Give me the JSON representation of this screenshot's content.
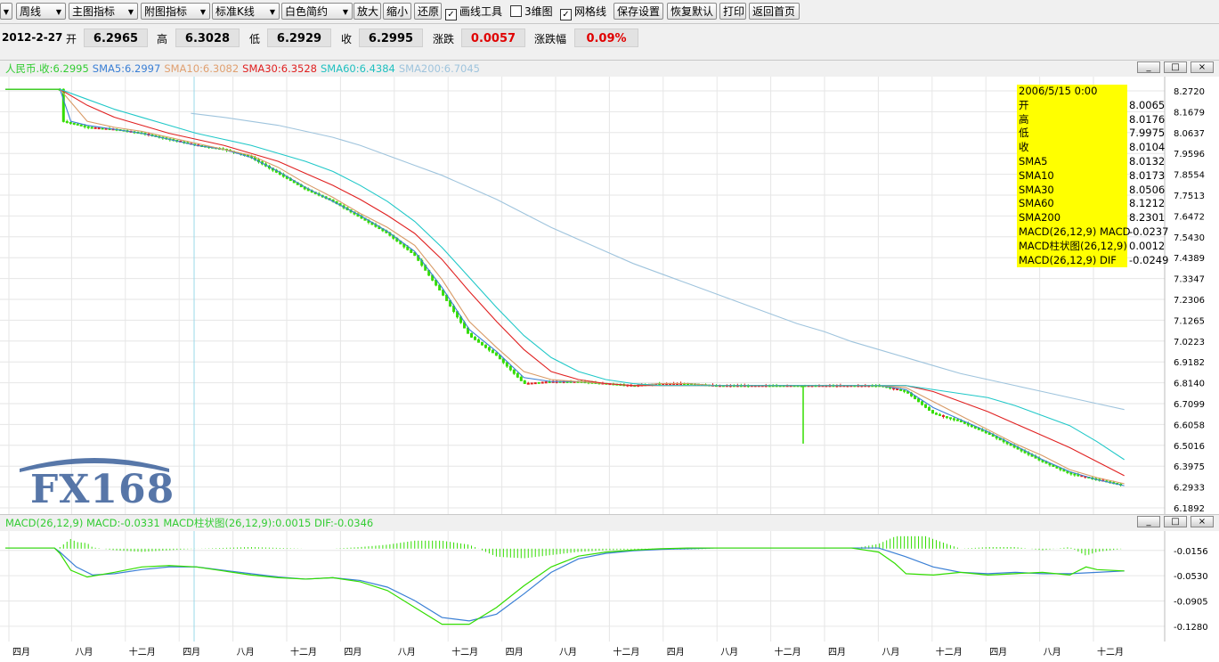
{
  "toolbar": {
    "period": "周线",
    "main_indicator": "主图指标",
    "sub_indicator": "附图指标",
    "kline_type": "标准K线",
    "theme": "白色简约",
    "zoom_in": "放大",
    "zoom_out": "缩小",
    "restore": "还原",
    "draw_tools": "画线工具",
    "three_d": "3维图",
    "grid": "网格线",
    "save_settings": "保存设置",
    "reset_default": "恢复默认",
    "print": "打印",
    "home": "返回首页",
    "draw_tools_checked": true,
    "three_d_checked": false,
    "grid_checked": true
  },
  "quote": {
    "date": "2012-2-27",
    "open_label": "开",
    "open": "6.2965",
    "high_label": "高",
    "high": "6.3028",
    "low_label": "低",
    "low": "6.2929",
    "close_label": "收",
    "close": "6.2995",
    "change_label": "涨跌",
    "change": "0.0057",
    "pct_label": "涨跌幅",
    "pct": "0.09%"
  },
  "main_legend": [
    {
      "text": "人民币.收:6.2995",
      "color": "#33cc33"
    },
    {
      "text": "SMA5:6.2997",
      "color": "#3a7fd5"
    },
    {
      "text": "SMA10:6.3082",
      "color": "#e0a070"
    },
    {
      "text": "SMA30:6.3528",
      "color": "#e02020"
    },
    {
      "text": "SMA60:6.4384",
      "color": "#20c0c0"
    },
    {
      "text": "SMA200:6.7045",
      "color": "#9fc4dd"
    }
  ],
  "macd_legend": "MACD(26,12,9) MACD:-0.0331 MACD柱状图(26,12,9):0.0015 DIF:-0.0346",
  "window_buttons": {
    "minimize": "_",
    "maximize": "□",
    "close": "×"
  },
  "tooltip": [
    {
      "label": "2006/5/15 0:00",
      "value": ""
    },
    {
      "label": "开",
      "value": "8.0065"
    },
    {
      "label": "高",
      "value": "8.0176"
    },
    {
      "label": "低",
      "value": "7.9975"
    },
    {
      "label": "收",
      "value": "8.0104"
    },
    {
      "label": "SMA5",
      "value": "8.0132"
    },
    {
      "label": "SMA10",
      "value": "8.0173"
    },
    {
      "label": "SMA30",
      "value": "8.0506"
    },
    {
      "label": "SMA60",
      "value": "8.1212"
    },
    {
      "label": "SMA200",
      "value": "8.2301"
    },
    {
      "label": "MACD(26,12,9) MACD",
      "value": "-0.0237"
    },
    {
      "label": "MACD柱状图(26,12,9)",
      "value": "0.0012"
    },
    {
      "label": "MACD(26,12,9) DIF",
      "value": "-0.0249"
    }
  ],
  "logo_text": "FX168",
  "colors": {
    "up": "#e02020",
    "down": "#33dd00",
    "grid": "#e6e6e6",
    "crosshair": "#9ad8ea",
    "tooltip_bg": "#ffff00"
  },
  "chart_data": [
    {
      "type": "line",
      "title": "",
      "y_ticks": [
        "8.2720",
        "8.1679",
        "8.0637",
        "7.9596",
        "7.8554",
        "7.7513",
        "7.6472",
        "7.5430",
        "7.4389",
        "7.3347",
        "7.2306",
        "7.1265",
        "7.0223",
        "6.9182",
        "6.8140",
        "6.7099",
        "6.6058",
        "6.5016",
        "6.3975",
        "6.2933",
        "6.1892"
      ],
      "ylim": [
        6.1892,
        8.272
      ],
      "x_ticks": [
        "四月",
        "八月",
        "十二月",
        "四月",
        "八月",
        "十二月",
        "四月",
        "八月",
        "十二月",
        "四月",
        "八月",
        "十二月",
        "四月",
        "八月",
        "十二月",
        "四月",
        "八月",
        "十二月",
        "四月",
        "八月",
        "十二月"
      ],
      "series": [
        {
          "name": "人民币.收",
          "x": [
            0,
            10,
            10.5,
            15,
            20,
            25,
            30,
            35,
            40,
            45,
            50,
            55,
            60,
            65,
            70,
            75,
            80,
            85,
            90,
            95,
            100,
            105,
            110,
            115,
            120,
            125,
            130,
            135,
            140,
            145,
            150,
            155,
            160,
            165,
            170,
            175,
            180,
            185,
            190,
            195,
            200,
            205
          ],
          "values": [
            8.28,
            8.28,
            8.12,
            8.09,
            8.08,
            8.06,
            8.03,
            8.0,
            7.98,
            7.94,
            7.86,
            7.78,
            7.72,
            7.64,
            7.56,
            7.45,
            7.26,
            7.05,
            6.95,
            6.81,
            6.82,
            6.82,
            6.81,
            6.8,
            6.81,
            6.81,
            6.8,
            6.8,
            6.8,
            6.8,
            6.8,
            6.8,
            6.8,
            6.77,
            6.66,
            6.62,
            6.56,
            6.49,
            6.42,
            6.36,
            6.33,
            6.3
          ]
        },
        {
          "name": "SMA5",
          "x": [
            0,
            10,
            12,
            15,
            20,
            25,
            30,
            35,
            40,
            45,
            50,
            55,
            60,
            65,
            70,
            75,
            80,
            85,
            90,
            95,
            100,
            105,
            110,
            115,
            120,
            125,
            130,
            135,
            140,
            145,
            150,
            155,
            160,
            165,
            170,
            175,
            180,
            185,
            190,
            195,
            200,
            205
          ],
          "values": [
            8.28,
            8.28,
            8.12,
            8.1,
            8.08,
            8.06,
            8.03,
            8.0,
            7.98,
            7.94,
            7.87,
            7.79,
            7.72,
            7.65,
            7.57,
            7.47,
            7.29,
            7.08,
            6.97,
            6.84,
            6.82,
            6.82,
            6.81,
            6.8,
            6.81,
            6.81,
            6.8,
            6.8,
            6.8,
            6.8,
            6.8,
            6.8,
            6.8,
            6.78,
            6.69,
            6.63,
            6.57,
            6.5,
            6.43,
            6.37,
            6.33,
            6.3
          ]
        },
        {
          "name": "SMA10",
          "x": [
            0,
            10,
            15,
            20,
            25,
            30,
            35,
            40,
            45,
            50,
            55,
            60,
            65,
            70,
            75,
            80,
            85,
            90,
            95,
            100,
            105,
            110,
            115,
            120,
            125,
            130,
            135,
            140,
            145,
            150,
            155,
            160,
            165,
            170,
            175,
            180,
            185,
            190,
            195,
            200,
            205
          ],
          "values": [
            8.28,
            8.28,
            8.12,
            8.09,
            8.07,
            8.04,
            8.01,
            7.98,
            7.95,
            7.89,
            7.81,
            7.74,
            7.66,
            7.59,
            7.5,
            7.33,
            7.12,
            6.99,
            6.87,
            6.83,
            6.82,
            6.81,
            6.8,
            6.81,
            6.81,
            6.8,
            6.8,
            6.8,
            6.8,
            6.8,
            6.8,
            6.8,
            6.79,
            6.72,
            6.65,
            6.58,
            6.51,
            6.45,
            6.38,
            6.34,
            6.31
          ]
        },
        {
          "name": "SMA30",
          "x": [
            0,
            10,
            15,
            20,
            25,
            30,
            35,
            40,
            45,
            50,
            55,
            60,
            65,
            70,
            75,
            80,
            85,
            90,
            95,
            100,
            105,
            110,
            115,
            120,
            125,
            130,
            135,
            140,
            145,
            150,
            155,
            160,
            165,
            170,
            175,
            180,
            185,
            190,
            195,
            200,
            205
          ],
          "values": [
            8.28,
            8.28,
            8.2,
            8.14,
            8.1,
            8.06,
            8.03,
            8.0,
            7.96,
            7.92,
            7.86,
            7.8,
            7.73,
            7.65,
            7.56,
            7.43,
            7.27,
            7.12,
            6.98,
            6.87,
            6.83,
            6.81,
            6.8,
            6.8,
            6.8,
            6.8,
            6.8,
            6.8,
            6.8,
            6.8,
            6.8,
            6.8,
            6.8,
            6.77,
            6.72,
            6.67,
            6.61,
            6.55,
            6.49,
            6.42,
            6.35
          ]
        },
        {
          "name": "SMA60",
          "x": [
            0,
            10,
            15,
            20,
            25,
            30,
            35,
            40,
            45,
            50,
            55,
            60,
            65,
            70,
            75,
            80,
            85,
            90,
            95,
            100,
            105,
            110,
            115,
            120,
            125,
            130,
            135,
            140,
            145,
            150,
            155,
            160,
            165,
            170,
            175,
            180,
            185,
            190,
            195,
            200,
            205
          ],
          "values": [
            8.28,
            8.28,
            8.23,
            8.18,
            8.14,
            8.1,
            8.06,
            8.03,
            8.0,
            7.96,
            7.92,
            7.87,
            7.8,
            7.72,
            7.62,
            7.49,
            7.34,
            7.19,
            7.05,
            6.94,
            6.87,
            6.83,
            6.81,
            6.8,
            6.8,
            6.8,
            6.8,
            6.8,
            6.8,
            6.8,
            6.8,
            6.8,
            6.8,
            6.78,
            6.76,
            6.74,
            6.7,
            6.65,
            6.6,
            6.52,
            6.43
          ]
        },
        {
          "name": "SMA200",
          "x": [
            34,
            40,
            45,
            50,
            55,
            60,
            65,
            70,
            75,
            80,
            85,
            90,
            95,
            100,
            105,
            110,
            115,
            120,
            125,
            130,
            135,
            140,
            145,
            150,
            155,
            160,
            165,
            170,
            175,
            180,
            185,
            190,
            195,
            200,
            205
          ],
          "values": [
            8.16,
            8.14,
            8.12,
            8.1,
            8.07,
            8.04,
            8.0,
            7.95,
            7.9,
            7.85,
            7.79,
            7.73,
            7.66,
            7.59,
            7.53,
            7.47,
            7.41,
            7.36,
            7.31,
            7.26,
            7.21,
            7.16,
            7.11,
            7.07,
            7.02,
            6.98,
            6.94,
            6.9,
            6.86,
            6.83,
            6.8,
            6.77,
            6.74,
            6.71,
            6.68
          ]
        }
      ]
    },
    {
      "type": "line",
      "title": "",
      "y_ticks": [
        "-0.0156",
        "-0.0530",
        "-0.0905",
        "-0.1280"
      ],
      "ylim": [
        -0.14,
        0.0
      ],
      "series": [
        {
          "name": "MACD",
          "x": [
            0,
            9,
            10,
            13,
            16,
            20,
            25,
            30,
            35,
            40,
            45,
            50,
            55,
            60,
            65,
            70,
            75,
            80,
            85,
            90,
            95,
            100,
            105,
            110,
            115,
            120,
            125,
            130,
            135,
            140,
            145,
            150,
            155,
            160,
            165,
            170,
            175,
            180,
            185,
            190,
            195,
            200,
            205
          ],
          "values": [
            -0.012,
            -0.012,
            -0.018,
            -0.04,
            -0.052,
            -0.05,
            -0.044,
            -0.04,
            -0.04,
            -0.045,
            -0.05,
            -0.055,
            -0.058,
            -0.056,
            -0.06,
            -0.07,
            -0.09,
            -0.115,
            -0.12,
            -0.11,
            -0.08,
            -0.048,
            -0.028,
            -0.02,
            -0.016,
            -0.014,
            -0.013,
            -0.012,
            -0.012,
            -0.012,
            -0.012,
            -0.012,
            -0.012,
            -0.012,
            -0.025,
            -0.04,
            -0.048,
            -0.05,
            -0.048,
            -0.05,
            -0.05,
            -0.048,
            -0.046
          ]
        },
        {
          "name": "DIF",
          "x": [
            0,
            9,
            10,
            12,
            15,
            20,
            25,
            30,
            35,
            40,
            45,
            50,
            55,
            60,
            65,
            70,
            75,
            80,
            85,
            90,
            95,
            100,
            105,
            110,
            115,
            120,
            125,
            130,
            135,
            140,
            145,
            150,
            155,
            160,
            163,
            165,
            170,
            175,
            180,
            185,
            190,
            195,
            198,
            200,
            205
          ],
          "values": [
            -0.012,
            -0.012,
            -0.02,
            -0.045,
            -0.055,
            -0.048,
            -0.04,
            -0.038,
            -0.04,
            -0.046,
            -0.052,
            -0.056,
            -0.058,
            -0.056,
            -0.062,
            -0.075,
            -0.1,
            -0.125,
            -0.125,
            -0.1,
            -0.068,
            -0.04,
            -0.024,
            -0.018,
            -0.015,
            -0.013,
            -0.012,
            -0.012,
            -0.012,
            -0.012,
            -0.012,
            -0.012,
            -0.012,
            -0.018,
            -0.035,
            -0.05,
            -0.052,
            -0.048,
            -0.052,
            -0.05,
            -0.048,
            -0.052,
            -0.04,
            -0.044,
            -0.046
          ]
        }
      ]
    }
  ]
}
